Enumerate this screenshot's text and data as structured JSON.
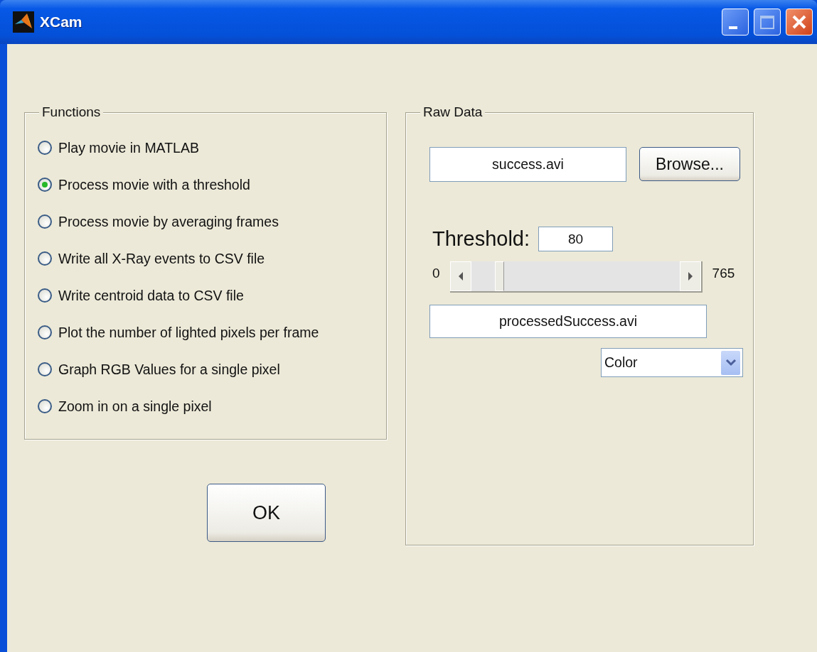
{
  "window": {
    "title": "XCam"
  },
  "functions": {
    "title": "Functions",
    "options": [
      {
        "label": "Play movie in MATLAB",
        "selected": false
      },
      {
        "label": "Process movie with a threshold",
        "selected": true
      },
      {
        "label": "Process movie by averaging frames",
        "selected": false
      },
      {
        "label": "Write all X-Ray events to CSV file",
        "selected": false
      },
      {
        "label": "Write centroid data to CSV file",
        "selected": false
      },
      {
        "label": "Plot the number of lighted pixels per frame",
        "selected": false
      },
      {
        "label": "Graph RGB Values for a single pixel",
        "selected": false
      },
      {
        "label": "Zoom in on a single pixel",
        "selected": false
      }
    ]
  },
  "ok_button": "OK",
  "raw_data": {
    "title": "Raw Data",
    "input_file": "success.avi",
    "browse_button": "Browse...",
    "threshold_label": "Threshold:",
    "threshold_value": "80",
    "slider": {
      "min_label": "0",
      "max_label": "765"
    },
    "output_file": "processedSuccess.avi",
    "mode_dropdown": "Color"
  }
}
